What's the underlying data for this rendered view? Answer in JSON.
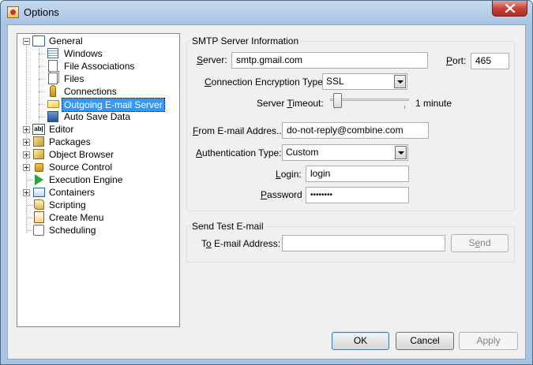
{
  "window": {
    "title": "Options",
    "close_icon": "close-icon"
  },
  "tree": {
    "items": [
      {
        "label": "General",
        "icon": "monitor-icon",
        "expander": "minus"
      },
      {
        "label": "Windows",
        "icon": "window-list-icon"
      },
      {
        "label": "File Associations",
        "icon": "file-association-icon"
      },
      {
        "label": "Files",
        "icon": "files-icon"
      },
      {
        "label": "Connections",
        "icon": "connections-icon"
      },
      {
        "label": "Outgoing E-mail Server",
        "icon": "envelope-icon",
        "selected": true
      },
      {
        "label": "Auto Save Data",
        "icon": "auto-save-icon"
      },
      {
        "label": "Editor",
        "icon": "editor-icon",
        "expander": "plus"
      },
      {
        "label": "Packages",
        "icon": "packages-icon",
        "expander": "plus"
      },
      {
        "label": "Object Browser",
        "icon": "object-browser-icon",
        "expander": "plus"
      },
      {
        "label": "Source Control",
        "icon": "source-control-icon",
        "expander": "plus"
      },
      {
        "label": "Execution Engine",
        "icon": "execution-engine-icon"
      },
      {
        "label": "Containers",
        "icon": "containers-icon",
        "expander": "plus"
      },
      {
        "label": "Scripting",
        "icon": "scripting-icon"
      },
      {
        "label": "Create Menu",
        "icon": "create-menu-icon"
      },
      {
        "label": "Scheduling",
        "icon": "scheduling-icon"
      }
    ]
  },
  "smtp": {
    "title": "SMTP Server Information",
    "server_label_u": "S",
    "server_label_rest": "erver:",
    "server_value": "smtp.gmail.com",
    "port_label_u": "P",
    "port_label_rest": "ort:",
    "port_value": "465",
    "encryption_label_u": "C",
    "encryption_label_rest": "onnection Encryption Type:",
    "encryption_value": "SSL",
    "timeout_label_a": "Server ",
    "timeout_label_u": "T",
    "timeout_label_rest": "imeout:",
    "timeout_value": "1 minute",
    "timeout_slider_fraction": 0.05,
    "from_label_u": "F",
    "from_label_rest": "rom E-mail Addres...",
    "from_value": "do-not-reply@combine.com",
    "auth_label_u": "A",
    "auth_label_rest": "uthentication Type:",
    "auth_value": "Custom",
    "login_label_u": "L",
    "login_label_rest": "ogin:",
    "login_value": "login",
    "password_label_u": "P",
    "password_label_rest": "assword",
    "password_value": "••••••••"
  },
  "test": {
    "title": "Send Test E-mail",
    "to_label_a": "T",
    "to_label_u": "o",
    "to_label_rest": " E-mail Address:",
    "to_value": "",
    "send_label_a": "S",
    "send_label_u": "e",
    "send_label_rest": "nd"
  },
  "buttons": {
    "ok": "OK",
    "cancel": "Cancel",
    "apply": "Apply"
  }
}
